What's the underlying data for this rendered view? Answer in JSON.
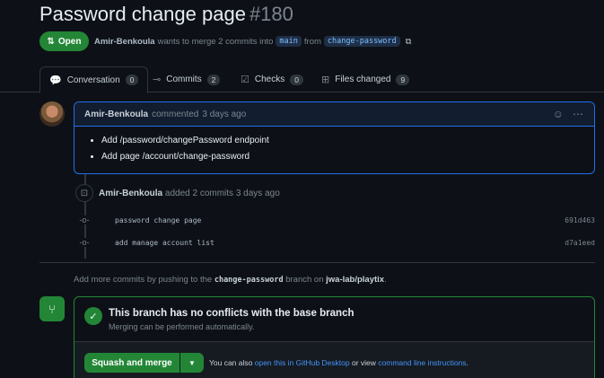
{
  "pr": {
    "title": "Password change page",
    "number": "#180",
    "state": "Open",
    "author": "Amir-Benkoula",
    "meta_text": "wants to merge 2 commits into",
    "base_branch": "main",
    "from_text": "from",
    "head_branch": "change-password"
  },
  "tabs": [
    {
      "label": "Conversation",
      "count": "0",
      "icon": "conversation-icon"
    },
    {
      "label": "Commits",
      "count": "2",
      "icon": "commit-icon"
    },
    {
      "label": "Checks",
      "count": "0",
      "icon": "checklist-icon"
    },
    {
      "label": "Files changed",
      "count": "9",
      "icon": "file-diff-icon"
    }
  ],
  "comment": {
    "author": "Amir-Benkoula",
    "action": "commented",
    "time": "3 days ago",
    "items": [
      "Add /password/changePassword endpoint",
      "Add page /account/change-password"
    ]
  },
  "timeline": {
    "author": "Amir-Benkoula",
    "action": "added 2 commits",
    "time": "3 days ago",
    "commits": [
      {
        "message": "password change page",
        "sha": "691d463"
      },
      {
        "message": "add manage account list",
        "sha": "d7a1eed"
      }
    ]
  },
  "hint": {
    "prefix": "Add more commits by pushing to the",
    "branch": "change-password",
    "middle": "branch on",
    "repo": "jwa-lab/playtix",
    "suffix": "."
  },
  "merge": {
    "title": "This branch has no conflicts with the base branch",
    "subtitle": "Merging can be performed automatically.",
    "button_label": "Squash and merge",
    "note_prefix": "You can also",
    "desktop_link": "open this in GitHub Desktop",
    "note_middle": "or view",
    "cli_link": "command line instructions",
    "note_suffix": "."
  },
  "colors": {
    "background": "#0d1117",
    "accent_green": "#238636",
    "accent_blue": "#1f6feb",
    "link": "#4493f8"
  }
}
